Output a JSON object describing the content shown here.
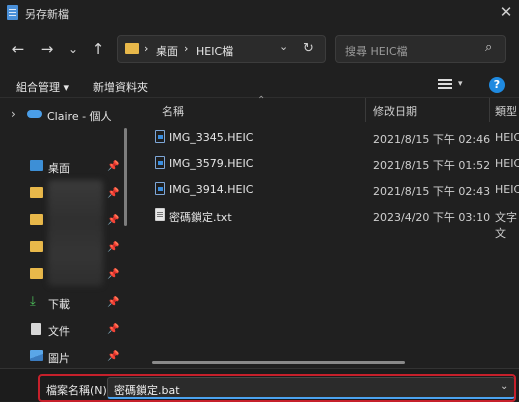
{
  "window": {
    "title": "另存新檔",
    "close_icon": "close-icon"
  },
  "nav": {
    "back": "←",
    "forward": "→",
    "recent": "⌄",
    "up": "↑",
    "refresh": "↻"
  },
  "address": {
    "segments": [
      "桌面",
      "HEIC檔"
    ],
    "separator": "›",
    "dropdown": "⌄"
  },
  "search": {
    "placeholder": "搜尋 HEIC檔",
    "icon": "⌕"
  },
  "toolbar": {
    "organize_label": "組合管理 ▾",
    "new_folder_label": "新增資料夾",
    "help": "?"
  },
  "sidebar": {
    "expand": "›",
    "cloud": {
      "label": "Claire - 個人"
    },
    "items": [
      {
        "label": "桌面",
        "pin": "📌"
      },
      {
        "label": "",
        "pin": "📌"
      },
      {
        "label": "",
        "pin": "📌"
      },
      {
        "label": "",
        "pin": "📌"
      },
      {
        "label": "",
        "pin": "📌"
      },
      {
        "label": "下載",
        "pin": "📌"
      },
      {
        "label": "文件",
        "pin": "📌"
      },
      {
        "label": "圖片",
        "pin": "📌"
      }
    ]
  },
  "columns": {
    "name": "名稱",
    "modified": "修改日期",
    "type": "類型",
    "sort_arrow": "⌃"
  },
  "files": [
    {
      "name": "IMG_3345.HEIC",
      "date": "2021/8/15 下午 02:46",
      "type": "HEIC"
    },
    {
      "name": "IMG_3579.HEIC",
      "date": "2021/8/15 下午 01:52",
      "type": "HEIC"
    },
    {
      "name": "IMG_3914.HEIC",
      "date": "2021/8/15 下午 02:43",
      "type": "HEIC"
    },
    {
      "name": "密碼鎖定.txt",
      "date": "2023/4/20 下午 03:10",
      "type": "文字文"
    }
  ],
  "filename": {
    "label": "檔案名稱(N):",
    "value": "密碼鎖定.bat",
    "dropdown": "⌄"
  },
  "colors": {
    "accent": "#1f8ae0",
    "highlight_border": "#c6202b",
    "folder": "#e8b84a",
    "background": "#202020"
  }
}
